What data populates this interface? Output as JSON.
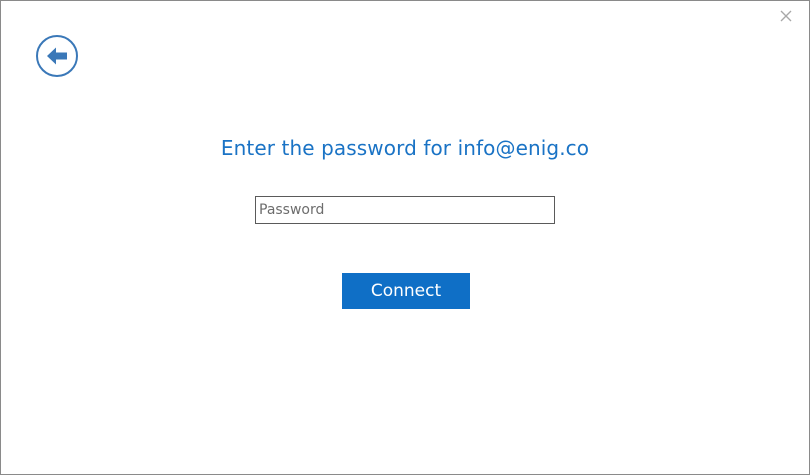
{
  "dialog": {
    "title": "Enter the password for info@enig.co",
    "password_placeholder": "Password",
    "password_value": "",
    "connect_label": "Connect"
  },
  "icons": {
    "back": "back-arrow-icon",
    "close": "close-icon"
  },
  "colors": {
    "accent": "#0f6fc6",
    "title_text": "#1a73c5",
    "back_icon": "#3a78b8",
    "close_icon": "#a8a8a8",
    "border": "#8a8a8a"
  }
}
